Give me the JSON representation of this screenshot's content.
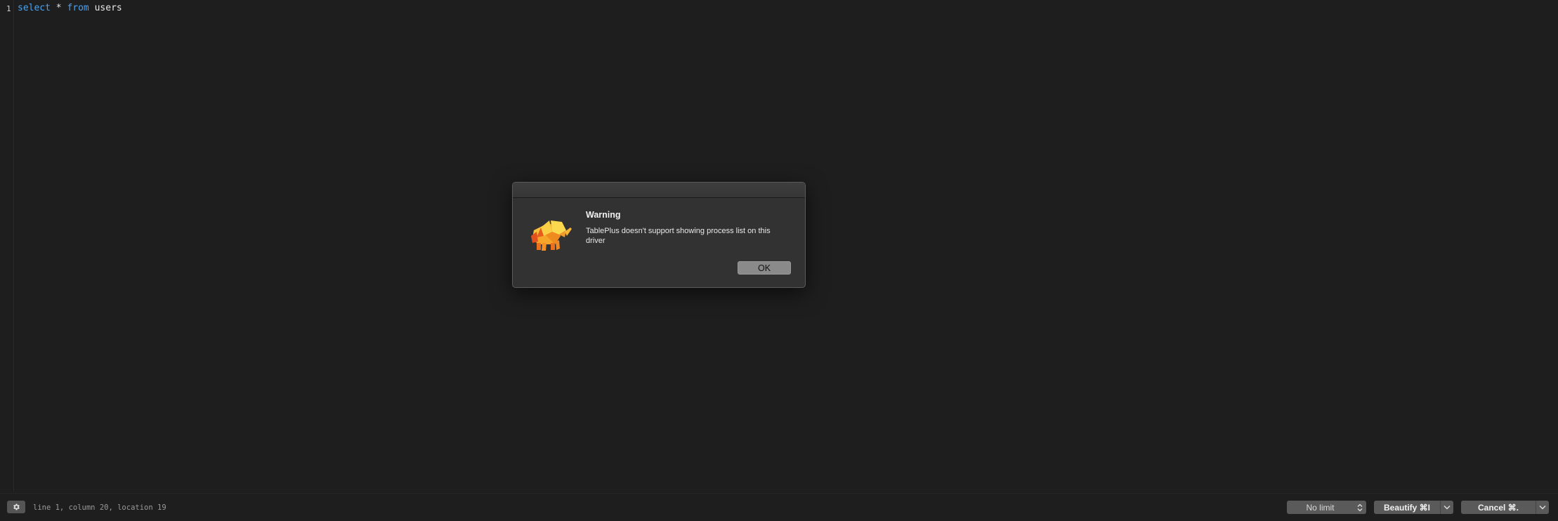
{
  "editor": {
    "line_number": "1",
    "code": {
      "keyword_select": "select",
      "operator_star": "*",
      "keyword_from": "from",
      "table": "users"
    }
  },
  "dialog": {
    "title": "Warning",
    "message": "TablePlus doesn't support showing process list on this driver",
    "ok_label": "OK",
    "icon": "tableplus-elephant-logo"
  },
  "statusbar": {
    "settings_icon": "gear-icon",
    "cursor_info": "line 1, column 20, location 19",
    "limit_label": "No limit",
    "beautify_label": "Beautify ⌘I",
    "cancel_label": "Cancel ⌘."
  },
  "colors": {
    "background": "#1e1e1e",
    "keyword": "#4aa3f0",
    "dialog_bg": "#323232",
    "button_bg": "#5a5a5a"
  }
}
